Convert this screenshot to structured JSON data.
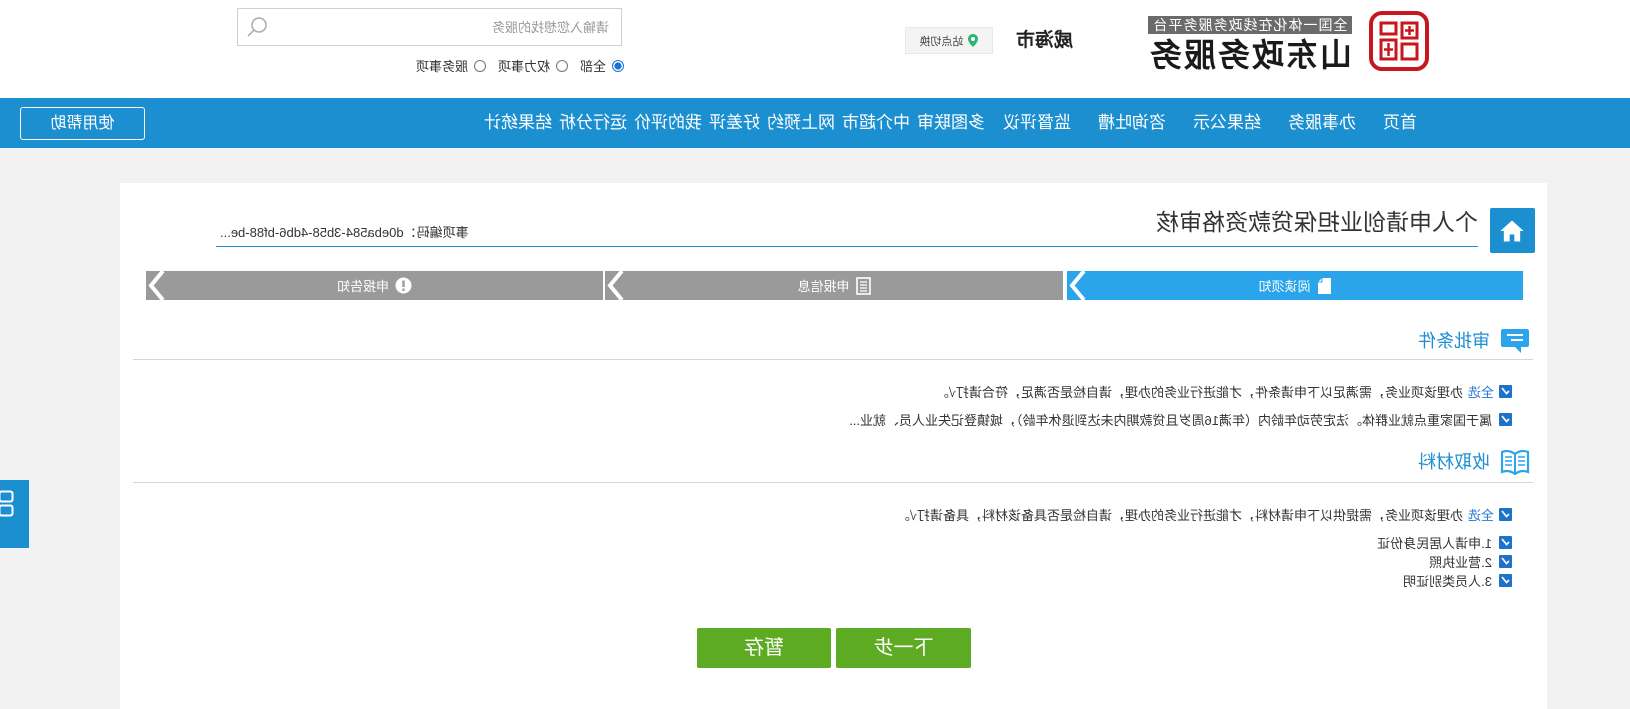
{
  "header": {
    "platform_tagline": "全国一体化在线政务服务平台",
    "site_name": "山东政务服务",
    "city": "威海市",
    "switch_label": "站点切换",
    "search": {
      "placeholder": "请输入您想找的服务",
      "value": ""
    },
    "scope_options": [
      {
        "label": "全部",
        "checked": true
      },
      {
        "label": "权力事项",
        "checked": false
      },
      {
        "label": "服务事项",
        "checked": false
      }
    ]
  },
  "nav": {
    "items": [
      "首页",
      "办事服务",
      "结果公示",
      "咨询吐槽",
      "监督评议",
      "多图联审",
      "中介超市",
      "网上预约",
      "好差评",
      "我的评价",
      "运行分析",
      "结果统计"
    ],
    "help_label": "使用帮助"
  },
  "matter": {
    "title": "个人申请创业担保贷款资格审核",
    "code": "事项编码：d0eba584-3b58-4db6-bf88-be..."
  },
  "steps": [
    {
      "label": "阅读须知",
      "icon": "document-icon",
      "active": true
    },
    {
      "label": "申报信息",
      "icon": "form-list-icon",
      "active": false
    },
    {
      "label": "申报告知",
      "icon": "exclamation-circle-icon",
      "active": false
    }
  ],
  "conditions": {
    "title": "审批条件",
    "icon": "chat-bubble-icon",
    "select_all_label": "全选",
    "intro": "办理该项业务，需满足以下申请条件，才能进行业务的办理，请自检是否满足，符合请打√。",
    "items": [
      {
        "text": "属于国家重点就业群体。法定劳动年龄内（年满16周岁且贷款期内未达到退休年龄），城镇登记失业人员、就业...",
        "checked": true
      }
    ]
  },
  "materials": {
    "title": "收取材料",
    "icon": "book-icon",
    "select_all_label": "全选",
    "intro": "办理该项业务，需提供以下申请材料，才能进行业务的办理，请自检是否具备该材料，具备请打√。",
    "items": [
      {
        "text": "1.申请人居民身份证",
        "checked": true
      },
      {
        "text": "2.营业执照",
        "checked": true
      },
      {
        "text": "3.人员类别证明",
        "checked": true
      }
    ]
  },
  "actions": {
    "next_label": "下一步",
    "save_label": "暂存"
  },
  "colors": {
    "nav": "#1b8fd0",
    "step_active": "#2aa4ea",
    "step_inactive": "#9a9a9a",
    "button_green": "#5dab22",
    "section_title": "#1f8fd2",
    "seal_red": "#c8161d",
    "checkbox": "#1d73c9"
  }
}
